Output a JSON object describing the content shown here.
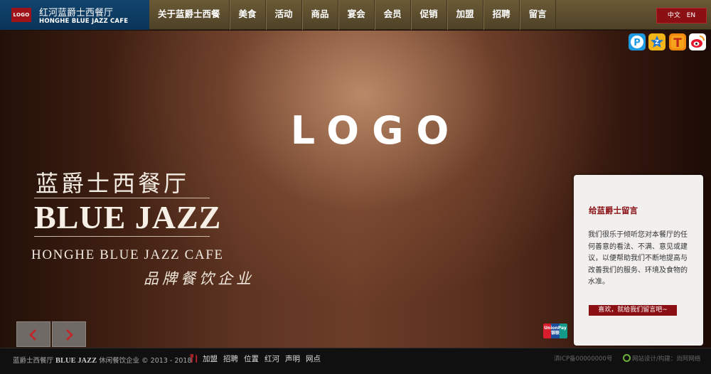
{
  "header": {
    "logo_text": "LOGO",
    "brand_cn": "红河蓝爵士西餐厅",
    "brand_en": "HONGHE BLUE JAZZ CAFE",
    "nav": [
      "关于蓝爵士西餐",
      "美食",
      "活动",
      "商品",
      "宴会",
      "会员",
      "促销",
      "加盟",
      "招聘",
      "留言"
    ],
    "lang_cn": "中文",
    "lang_en": "EN"
  },
  "hero": {
    "logo_text": "LOGO",
    "brand_cn": "蓝爵士西餐厅",
    "brand_en": "BLUE JAZZ",
    "brand_en_full": "HONGHE BLUE JAZZ CAFE",
    "slogan": "品牌餐饮企业",
    "social_icons": [
      "weibo-icon",
      "tencent-weibo-icon",
      "qzone-icon",
      "pengyou-icon"
    ]
  },
  "message_panel": {
    "title": "给蓝爵士留言",
    "body": "我们很乐于倾听您对本餐厅的任何善意的看法、不满、意见或建议，以便帮助我们不断地提高与改善我们的服务、环境及食物的水准。",
    "button": "喜欢，就给我们留言吧~"
  },
  "footer": {
    "name_cn": "蓝爵士西餐厅",
    "name_en": "BLUE JAZZ",
    "subtitle": "休闲餐饮企业 © 2013 - 2018",
    "links": [
      "加盟",
      "招聘",
      "位置",
      "红河",
      "声明",
      "网点"
    ],
    "icp": "滇ICP备00000000号",
    "credit": "网站设计/构建：尚阿网络"
  },
  "colors": {
    "accent": "#8b1014",
    "nav_bg": "#5e4f30",
    "brand_bg": "#0e3c64"
  }
}
